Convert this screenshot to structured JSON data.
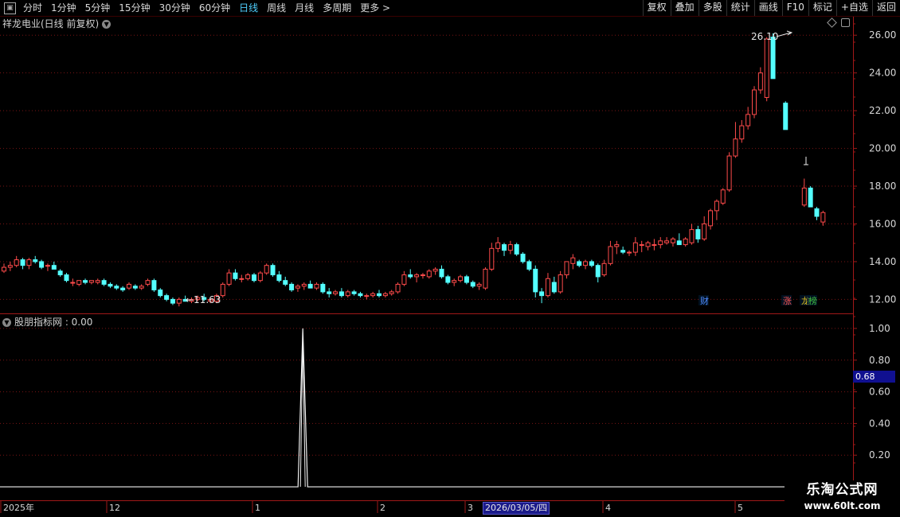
{
  "toolbar": {
    "periods": [
      {
        "label": "分时",
        "active": false
      },
      {
        "label": "1分钟",
        "active": false
      },
      {
        "label": "5分钟",
        "active": false
      },
      {
        "label": "15分钟",
        "active": false
      },
      {
        "label": "30分钟",
        "active": false
      },
      {
        "label": "60分钟",
        "active": false
      },
      {
        "label": "日线",
        "active": true
      },
      {
        "label": "周线",
        "active": false
      },
      {
        "label": "月线",
        "active": false
      },
      {
        "label": "多周期",
        "active": false
      },
      {
        "label": "更多 >",
        "active": false
      }
    ],
    "right_buttons": [
      "复权",
      "叠加",
      "多股",
      "统计",
      "画线",
      "F10",
      "标记",
      "+自选",
      "返回"
    ]
  },
  "stock": {
    "title": "祥龙电业(日线 前复权)"
  },
  "indicator": {
    "title": "股朋指标网 : 0.00",
    "cursor_value": "0.68"
  },
  "footer": {
    "selected_date": "2026/03/05/四"
  },
  "watermark": {
    "line1": "乐淘公式网",
    "line2": "www.60lt.com"
  },
  "colors": {
    "up": "#ff4b4b",
    "down": "#54ffff",
    "grid": "#7a1414",
    "axis_text": "#d8d8d8"
  },
  "chart_data": [
    {
      "type": "candlestick",
      "y_ticks": [
        "26.00",
        "24.00",
        "22.00",
        "20.00",
        "18.00",
        "16.00",
        "14.00",
        "12.00"
      ],
      "ylim": [
        11.3,
        26.6
      ],
      "grid": true,
      "annotations": {
        "high_label": "26.10",
        "low_label": "11.63"
      },
      "markers": [
        {
          "label": "财",
          "color": "#4f8cff"
        },
        {
          "label": "涨",
          "color": "#ff5555"
        },
        {
          "label": "龙",
          "color": "#e0c020"
        },
        {
          "label": "榜",
          "color": "#40c040"
        }
      ],
      "ohlc": [
        [
          13.5,
          13.9,
          13.4,
          13.7
        ],
        [
          13.7,
          14.0,
          13.5,
          13.8
        ],
        [
          13.8,
          14.3,
          13.7,
          14.1
        ],
        [
          14.1,
          14.2,
          13.6,
          13.8
        ],
        [
          13.8,
          14.2,
          13.6,
          14.1
        ],
        [
          14.1,
          14.3,
          13.9,
          14.0
        ],
        [
          14.0,
          14.1,
          13.6,
          13.7
        ],
        [
          13.8,
          13.9,
          13.5,
          13.8
        ],
        [
          13.8,
          14.0,
          13.6,
          13.6
        ],
        [
          13.5,
          13.6,
          13.2,
          13.3
        ],
        [
          13.3,
          13.4,
          12.9,
          13.0
        ],
        [
          12.9,
          13.1,
          12.7,
          12.9
        ],
        [
          12.8,
          13.0,
          12.7,
          13.0
        ],
        [
          13.0,
          13.1,
          12.8,
          12.9
        ],
        [
          12.9,
          13.0,
          12.8,
          13.0
        ],
        [
          12.9,
          13.1,
          12.8,
          13.0
        ],
        [
          13.0,
          13.1,
          12.7,
          12.8
        ],
        [
          12.8,
          12.9,
          12.6,
          12.7
        ],
        [
          12.7,
          12.8,
          12.5,
          12.6
        ],
        [
          12.6,
          12.7,
          12.4,
          12.5
        ],
        [
          12.6,
          12.9,
          12.5,
          12.8
        ],
        [
          12.7,
          12.8,
          12.5,
          12.6
        ],
        [
          12.6,
          12.8,
          12.5,
          12.7
        ],
        [
          12.8,
          13.1,
          12.7,
          13.0
        ],
        [
          13.0,
          13.1,
          12.4,
          12.5
        ],
        [
          12.5,
          12.6,
          12.1,
          12.2
        ],
        [
          12.2,
          12.3,
          11.9,
          12.0
        ],
        [
          12.0,
          12.1,
          11.7,
          11.8
        ],
        [
          11.8,
          12.1,
          11.63,
          12.0
        ],
        [
          12.0,
          12.2,
          11.9,
          11.9
        ],
        [
          11.9,
          12.1,
          11.8,
          12.0
        ],
        [
          12.0,
          12.2,
          11.9,
          12.1
        ],
        [
          12.1,
          12.3,
          11.9,
          12.0
        ],
        [
          11.9,
          12.1,
          11.8,
          12.0
        ],
        [
          11.9,
          12.3,
          11.8,
          12.2
        ],
        [
          12.2,
          12.9,
          12.1,
          12.8
        ],
        [
          12.8,
          13.6,
          12.7,
          13.4
        ],
        [
          13.4,
          13.6,
          13.0,
          13.1
        ],
        [
          13.1,
          13.3,
          12.9,
          13.1
        ],
        [
          13.1,
          13.4,
          13.0,
          13.3
        ],
        [
          13.3,
          13.4,
          12.9,
          13.0
        ],
        [
          13.0,
          13.5,
          12.9,
          13.4
        ],
        [
          13.4,
          13.9,
          13.3,
          13.8
        ],
        [
          13.8,
          13.9,
          13.2,
          13.3
        ],
        [
          13.3,
          13.5,
          12.9,
          13.0
        ],
        [
          13.0,
          13.2,
          12.7,
          12.8
        ],
        [
          12.8,
          12.9,
          12.4,
          12.5
        ],
        [
          12.6,
          12.8,
          12.4,
          12.7
        ],
        [
          12.7,
          12.9,
          12.5,
          12.8
        ],
        [
          12.8,
          13.0,
          12.6,
          12.6
        ],
        [
          12.6,
          12.9,
          12.5,
          12.8
        ],
        [
          12.8,
          12.9,
          12.3,
          12.4
        ],
        [
          12.4,
          12.6,
          12.1,
          12.3
        ],
        [
          12.3,
          12.5,
          12.2,
          12.4
        ],
        [
          12.4,
          12.6,
          12.1,
          12.2
        ],
        [
          12.2,
          12.5,
          12.1,
          12.4
        ],
        [
          12.4,
          12.5,
          12.2,
          12.3
        ],
        [
          12.3,
          12.4,
          12.1,
          12.2
        ],
        [
          12.2,
          12.3,
          12.0,
          12.2
        ],
        [
          12.2,
          12.4,
          12.1,
          12.3
        ],
        [
          12.3,
          12.5,
          12.1,
          12.2
        ],
        [
          12.2,
          12.4,
          12.1,
          12.3
        ],
        [
          12.3,
          12.5,
          12.2,
          12.4
        ],
        [
          12.4,
          12.9,
          12.3,
          12.8
        ],
        [
          12.8,
          13.5,
          12.7,
          13.3
        ],
        [
          13.3,
          13.6,
          13.1,
          13.2
        ],
        [
          13.2,
          13.4,
          12.9,
          13.3
        ],
        [
          13.3,
          13.4,
          13.1,
          13.3
        ],
        [
          13.2,
          13.6,
          13.1,
          13.5
        ],
        [
          13.5,
          13.7,
          13.3,
          13.6
        ],
        [
          13.6,
          13.8,
          13.1,
          13.2
        ],
        [
          13.2,
          13.3,
          12.8,
          12.9
        ],
        [
          12.9,
          13.1,
          12.7,
          13.0
        ],
        [
          13.0,
          13.3,
          12.9,
          13.2
        ],
        [
          13.2,
          13.3,
          12.8,
          12.9
        ],
        [
          12.9,
          13.0,
          12.6,
          12.7
        ],
        [
          12.7,
          12.9,
          12.5,
          12.8
        ],
        [
          12.6,
          13.7,
          12.5,
          13.6
        ],
        [
          13.6,
          15.0,
          13.5,
          14.7
        ],
        [
          14.7,
          15.3,
          14.5,
          15.0
        ],
        [
          14.9,
          15.0,
          14.3,
          14.6
        ],
        [
          14.6,
          15.1,
          14.4,
          14.9
        ],
        [
          14.9,
          15.0,
          14.3,
          14.4
        ],
        [
          14.4,
          14.5,
          13.9,
          14.0
        ],
        [
          14.0,
          14.1,
          13.5,
          13.6
        ],
        [
          13.6,
          13.8,
          12.1,
          12.4
        ],
        [
          12.4,
          12.6,
          11.8,
          12.2
        ],
        [
          12.2,
          13.4,
          12.1,
          13.1
        ],
        [
          12.9,
          13.2,
          12.3,
          12.4
        ],
        [
          12.4,
          13.5,
          12.3,
          13.3
        ],
        [
          13.3,
          14.0,
          13.1,
          14.0
        ],
        [
          13.9,
          14.4,
          13.6,
          14.2
        ],
        [
          14.0,
          14.1,
          13.7,
          13.8
        ],
        [
          13.8,
          14.1,
          13.6,
          14.0
        ],
        [
          14.0,
          14.1,
          13.7,
          13.8
        ],
        [
          13.8,
          13.9,
          12.9,
          13.2
        ],
        [
          13.3,
          14.1,
          13.2,
          13.9
        ],
        [
          13.9,
          15.1,
          13.8,
          14.8
        ],
        [
          14.8,
          15.1,
          14.4,
          14.9
        ],
        [
          14.6,
          14.8,
          14.4,
          14.5
        ],
        [
          14.5,
          14.6,
          14.3,
          14.5
        ],
        [
          14.5,
          15.3,
          14.3,
          15.0
        ],
        [
          14.9,
          15.1,
          14.5,
          14.9
        ],
        [
          14.8,
          15.1,
          14.6,
          15.0
        ],
        [
          14.9,
          15.2,
          14.6,
          14.9
        ],
        [
          14.9,
          15.3,
          14.7,
          15.1
        ],
        [
          15.0,
          15.3,
          14.9,
          15.1
        ],
        [
          15.0,
          15.3,
          14.8,
          15.2
        ],
        [
          15.1,
          15.5,
          14.9,
          14.9
        ],
        [
          14.9,
          15.3,
          14.8,
          15.2
        ],
        [
          15.0,
          16.0,
          14.9,
          15.7
        ],
        [
          15.7,
          15.9,
          15.0,
          15.2
        ],
        [
          15.2,
          16.4,
          15.1,
          16.0
        ],
        [
          15.9,
          16.8,
          15.7,
          16.7
        ],
        [
          16.7,
          17.3,
          16.2,
          17.2
        ],
        [
          17.1,
          17.9,
          17.0,
          17.8
        ],
        [
          17.8,
          19.8,
          17.7,
          19.6
        ],
        [
          19.6,
          21.4,
          19.5,
          20.5
        ],
        [
          20.5,
          21.5,
          20.3,
          21.2
        ],
        [
          21.2,
          22.2,
          21.0,
          21.8
        ],
        [
          21.8,
          23.3,
          21.6,
          23.1
        ],
        [
          23.1,
          24.3,
          22.9,
          24.0
        ],
        [
          22.7,
          25.9,
          22.5,
          25.8
        ],
        [
          25.9,
          26.1,
          24.8,
          23.7
        ],
        [
          null,
          null,
          null,
          null
        ],
        [
          22.4,
          22.5,
          21.0,
          21.0
        ],
        [
          null,
          null,
          null,
          null
        ],
        [
          null,
          null,
          null,
          null
        ],
        [
          17.0,
          18.4,
          16.9,
          17.9
        ],
        [
          17.9,
          18.0,
          16.9,
          16.9
        ],
        [
          16.8,
          16.9,
          16.2,
          16.4
        ],
        [
          16.1,
          16.7,
          15.9,
          16.6
        ]
      ]
    },
    {
      "type": "line",
      "title": "股朋指标网 : 0.00",
      "y_ticks": [
        "1.00",
        "0.80",
        "0.60",
        "0.40",
        "0.20"
      ],
      "ylim": [
        -0.08,
        1.08
      ],
      "spike": {
        "value": 1.0,
        "bar_index": 42
      },
      "x_labels": [
        "2025年",
        "12",
        "1",
        "2",
        "3",
        "4",
        "5"
      ]
    }
  ]
}
